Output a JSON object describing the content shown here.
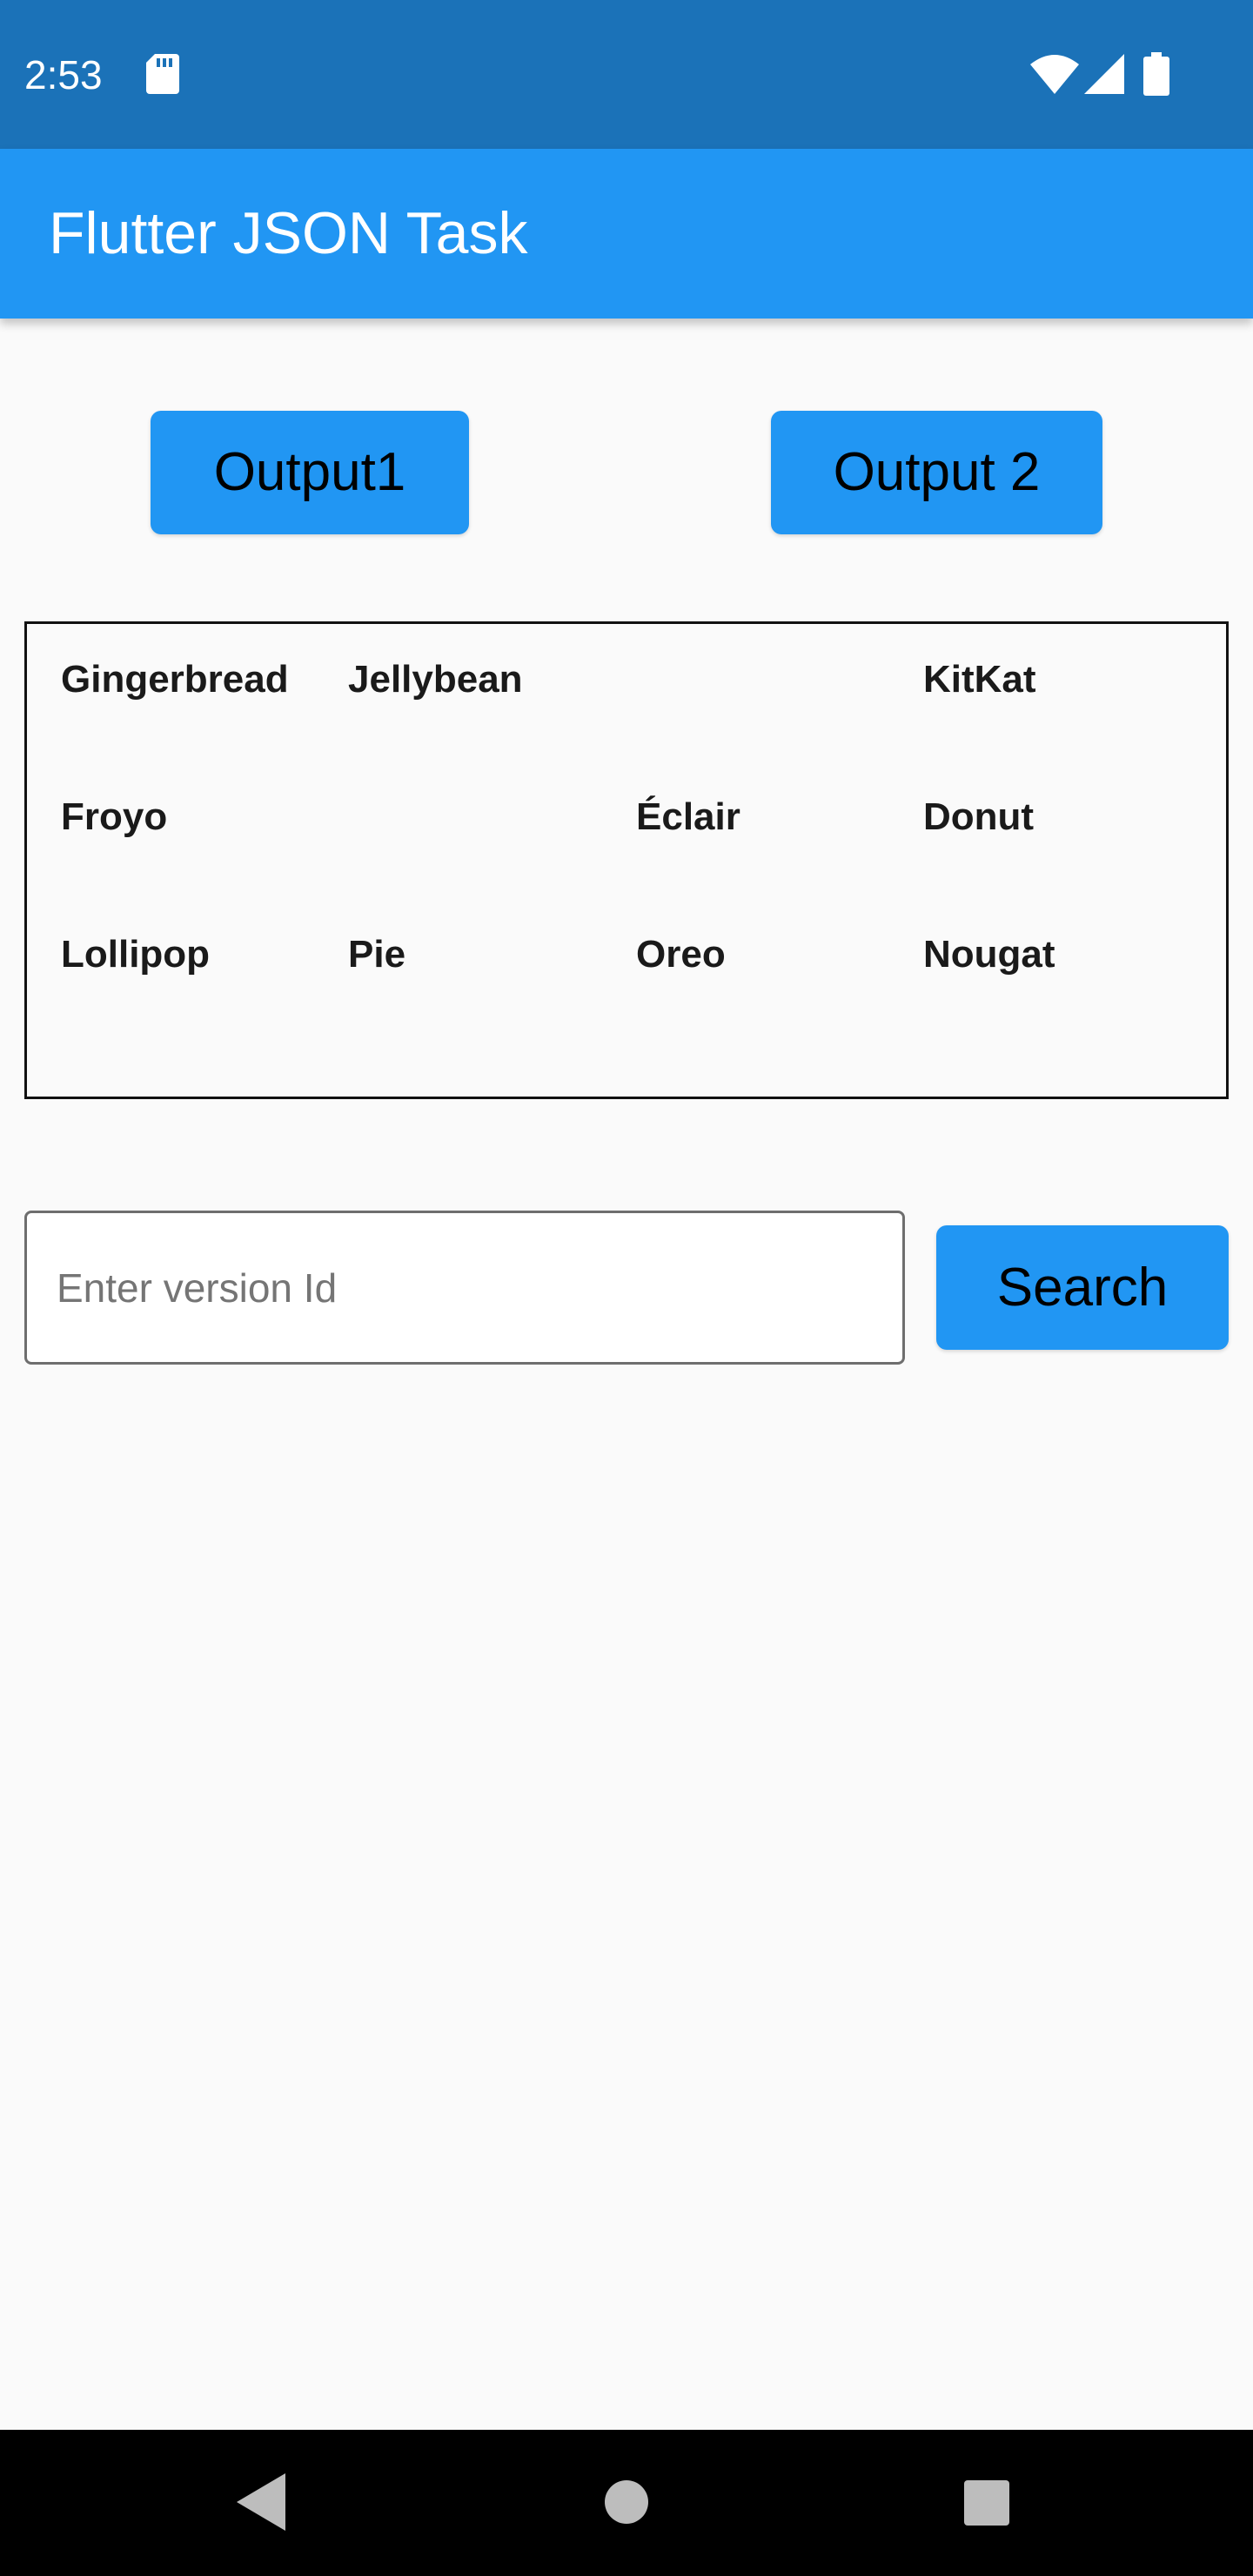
{
  "status_bar": {
    "time": "2:53",
    "icons": [
      "sd-card-icon",
      "wifi-icon",
      "cell-signal-icon",
      "battery-icon"
    ]
  },
  "app_bar": {
    "title": "Flutter JSON Task",
    "color": "#2196f3"
  },
  "buttons": {
    "output1": "Output1",
    "output2": "Output 2",
    "search": "Search"
  },
  "grid": {
    "rows": [
      [
        "Gingerbread",
        "Jellybean",
        "",
        "KitKat"
      ],
      [
        "Froyo",
        "",
        "Éclair",
        "Donut"
      ],
      [
        "Lollipop",
        "Pie",
        "Oreo",
        "Nougat"
      ]
    ]
  },
  "search": {
    "placeholder": "Enter version Id",
    "value": ""
  },
  "nav_bar": {
    "icons": [
      "back-icon",
      "home-icon",
      "recents-icon"
    ]
  },
  "colors": {
    "status_bar": "#1b72b8",
    "accent": "#2196f3",
    "background": "#fafafa"
  }
}
